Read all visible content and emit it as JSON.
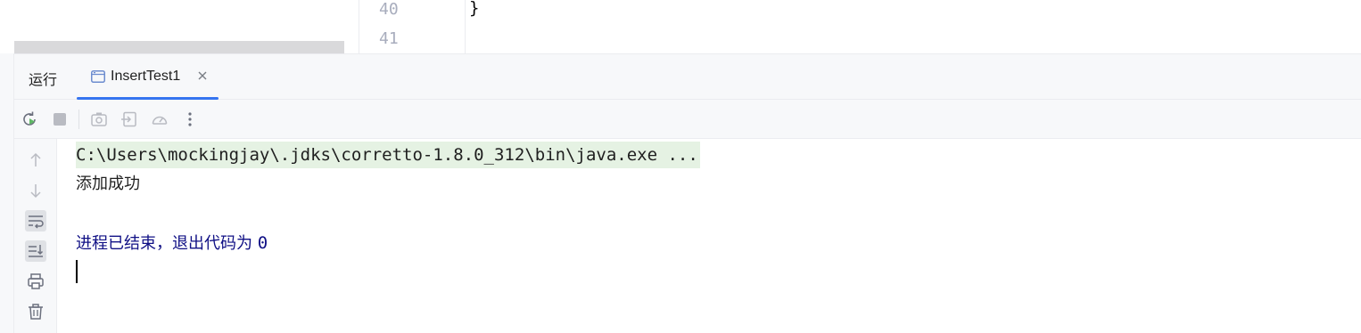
{
  "editor": {
    "line_numbers": [
      "40",
      "41"
    ],
    "code_lines": [
      "}",
      ""
    ]
  },
  "run_panel": {
    "title": "运行",
    "tab": {
      "label": "InsertTest1",
      "icon": "run-config-icon"
    }
  },
  "toolbar": {
    "icons": [
      "rerun-icon",
      "stop-icon",
      "camera-icon",
      "restore-layout-icon",
      "profiler-icon",
      "more-options-icon"
    ]
  },
  "side_actions": {
    "icons": [
      "scroll-up-icon",
      "scroll-down-icon",
      "soft-wrap-icon",
      "scroll-to-end-icon",
      "print-icon",
      "clear-all-icon"
    ]
  },
  "console": {
    "command": "C:\\Users\\mockingjay\\.jdks\\corretto-1.8.0_312\\bin\\java.exe ...",
    "output": "添加成功",
    "exit_message": "进程已结束，退出代码为",
    "exit_code": "0"
  },
  "colors": {
    "accent": "#3574f0",
    "command_highlight": "#e5f2e3",
    "exit_text": "#101085",
    "panel_bg": "#f7f8fa"
  }
}
